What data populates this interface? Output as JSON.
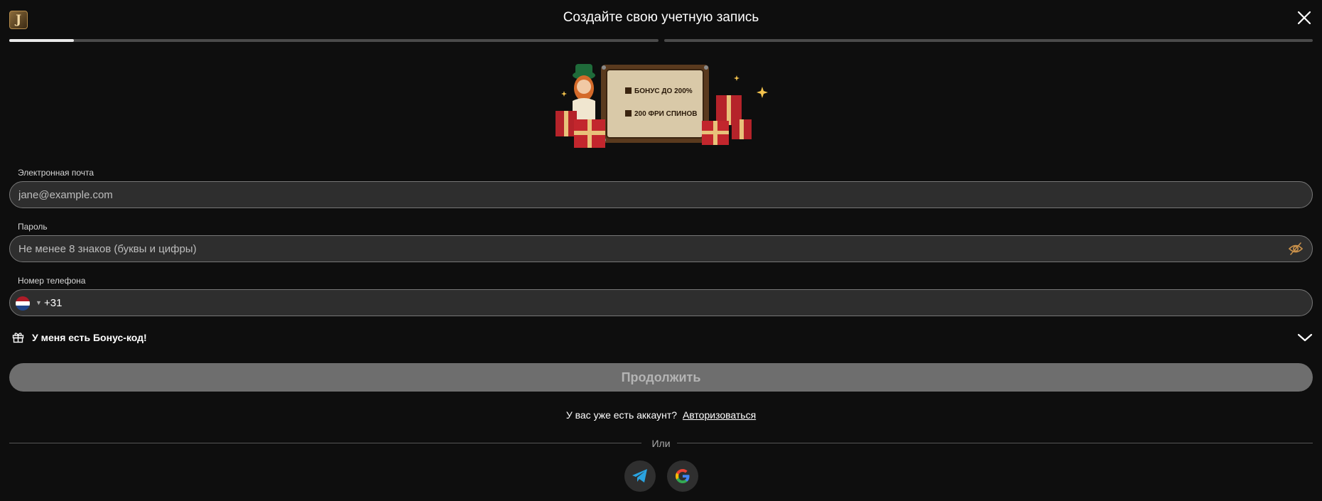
{
  "header": {
    "title": "Создайте свою учетную запись",
    "logo_letter": "J"
  },
  "progress": {
    "step1_fill": 0.1,
    "step2_fill": 0
  },
  "banner": {
    "line1": "БОНУС ДО 200%",
    "line2": "200 ФРИ СПИНОВ"
  },
  "form": {
    "email_label": "Электронная почта",
    "email_placeholder": "jane@example.com",
    "password_label": "Пароль",
    "password_placeholder": "Не менее 8 знаков (буквы и цифры)",
    "phone_label": "Номер телефона",
    "phone_code": "+31",
    "bonus_toggle": "У меня есть Бонус-код!",
    "continue_label": "Продолжить"
  },
  "footer": {
    "account_prompt": "У вас уже есть аккаунт?",
    "login_link": "Авторизоваться",
    "or_text": "Или"
  },
  "colors": {
    "background": "#0e0e0e",
    "field": "#2e2e2e",
    "button_disabled": "#6e6e6e",
    "eye_icon": "#c8904a",
    "telegram": "#2aa3e0"
  },
  "icons": {
    "close": "close-icon",
    "eye": "eye-off-icon",
    "gift": "gift-icon",
    "chevron": "chevron-down-icon",
    "flag": "netherlands-flag-icon",
    "telegram": "telegram-icon",
    "google": "google-icon"
  }
}
